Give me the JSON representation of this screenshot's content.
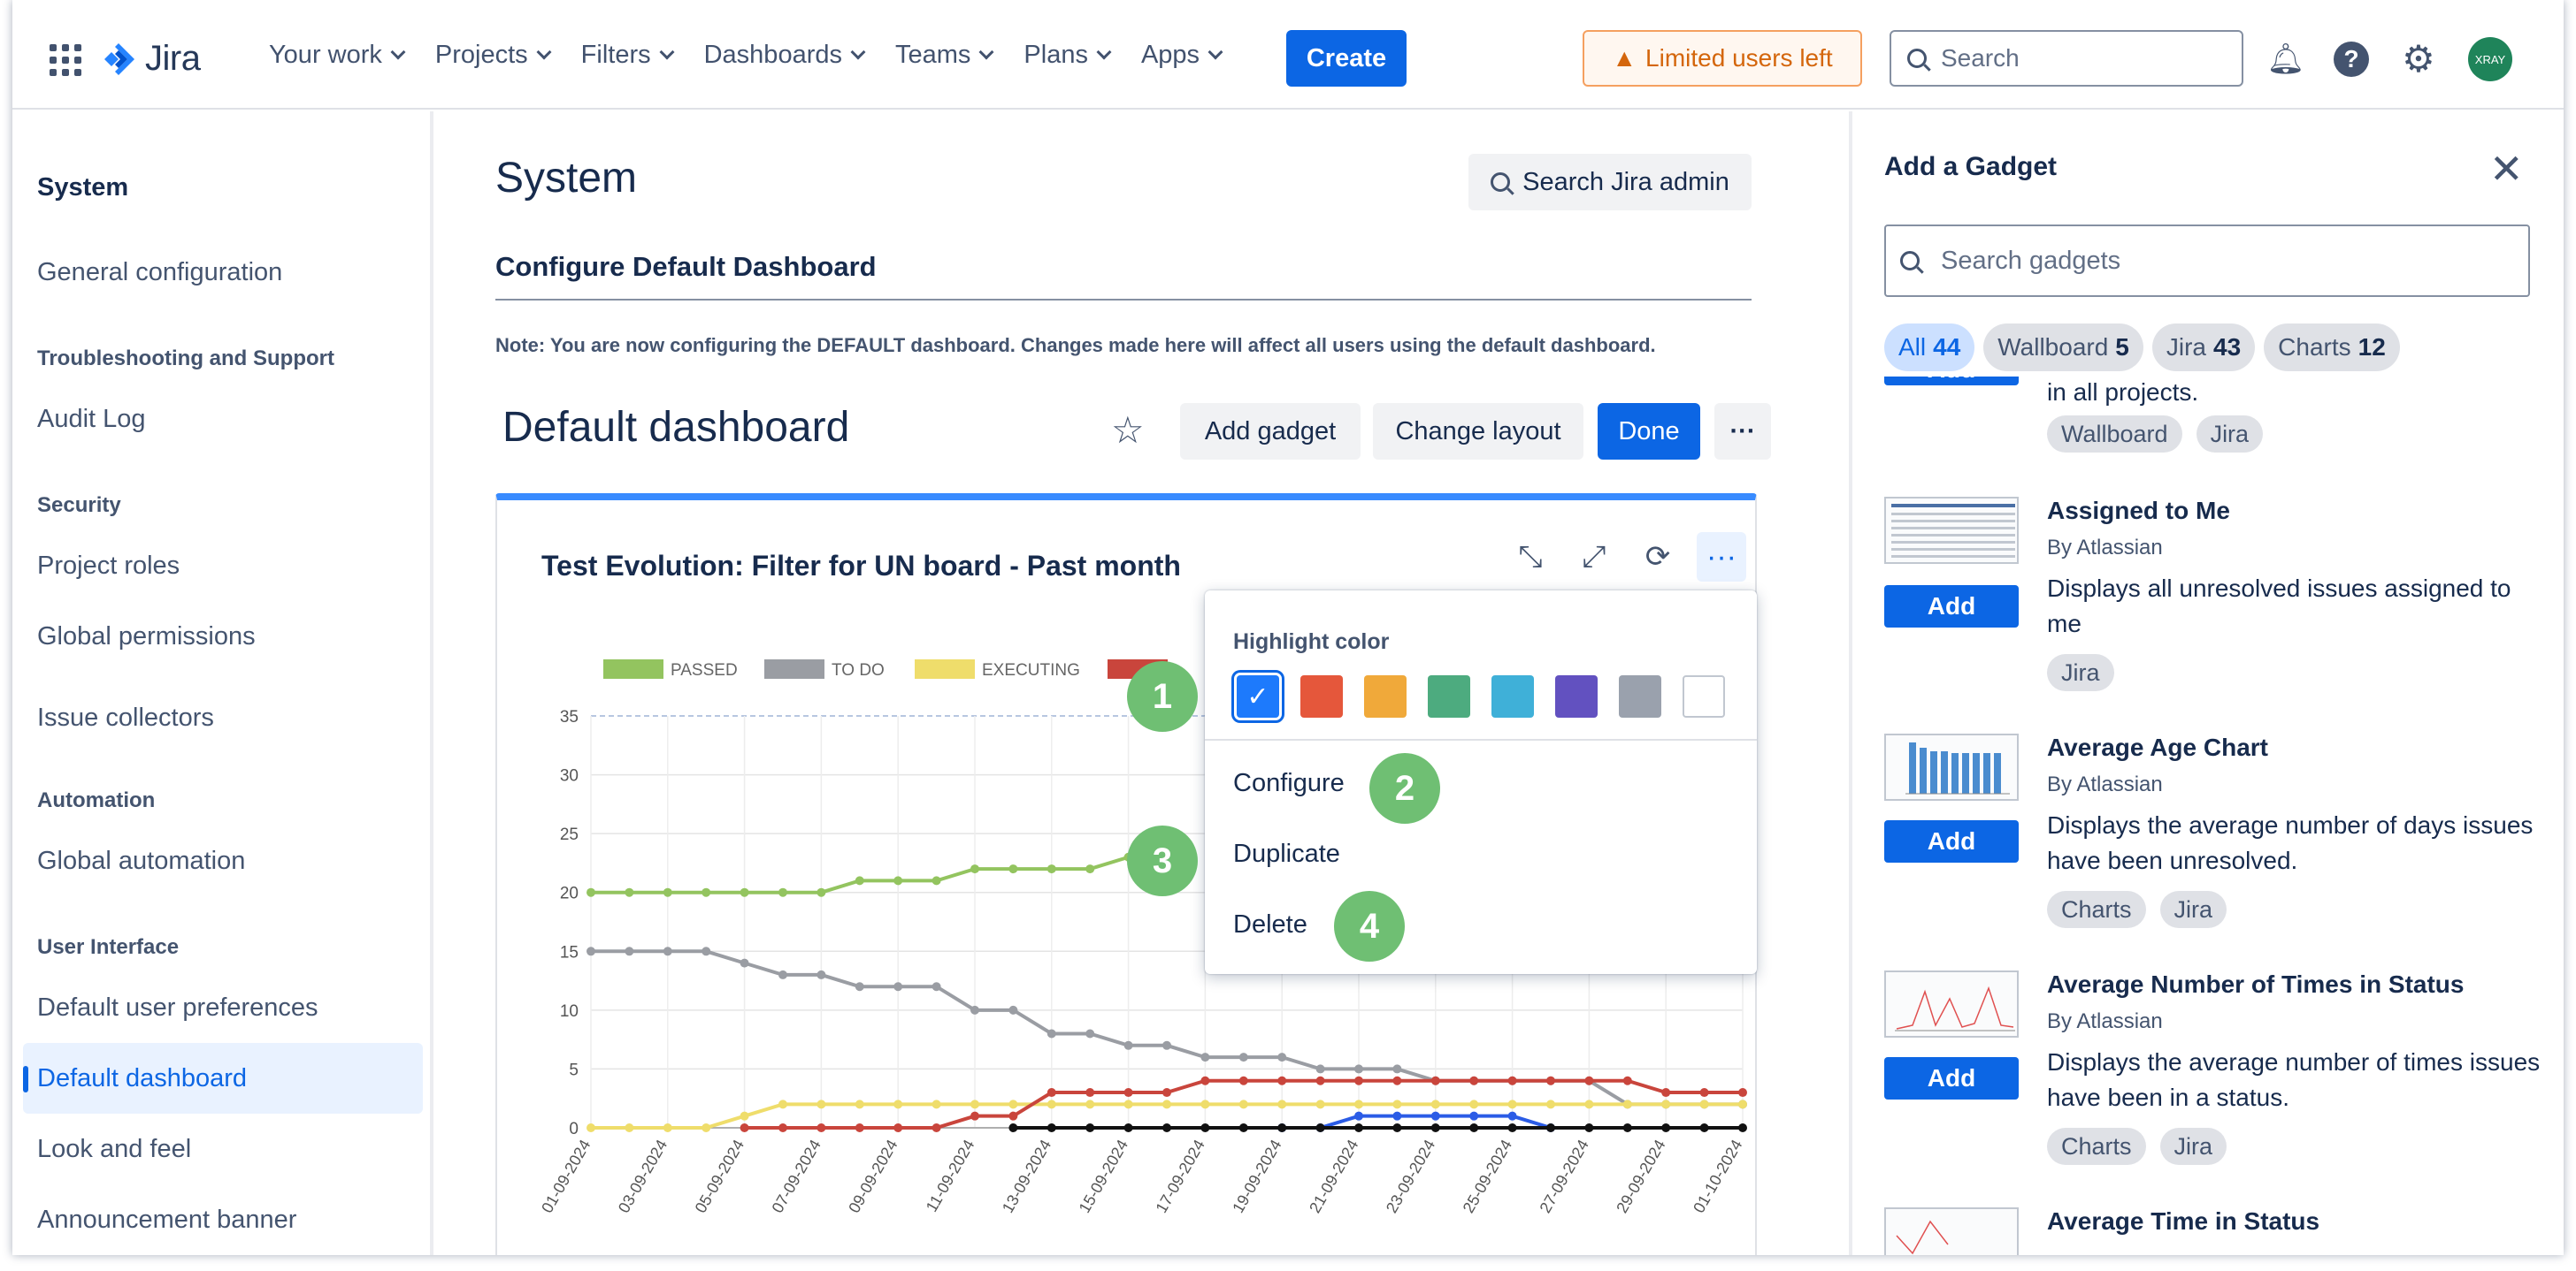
{
  "topnav": {
    "logo": "Jira",
    "items": [
      "Your work",
      "Projects",
      "Filters",
      "Dashboards",
      "Teams",
      "Plans",
      "Apps"
    ],
    "create": "Create",
    "limited": "Limited users left",
    "search_placeholder": "Search",
    "avatar": "XRAY"
  },
  "sidebar": {
    "title": "System",
    "general": "General configuration",
    "h_trouble": "Troubleshooting and Support",
    "audit": "Audit Log",
    "h_security": "Security",
    "project_roles": "Project roles",
    "global_permissions": "Global permissions",
    "issue_collectors": "Issue collectors",
    "h_automation": "Automation",
    "global_automation": "Global automation",
    "h_ui": "User Interface",
    "default_user_prefs": "Default user preferences",
    "default_dashboard": "Default dashboard",
    "look_feel": "Look and feel",
    "announcement": "Announcement banner"
  },
  "main": {
    "title": "System",
    "search_admin": "Search Jira admin",
    "configure_title": "Configure Default Dashboard",
    "note": "Note: You are now configuring the DEFAULT dashboard. Changes made here will affect all users using the default dashboard.",
    "dashboard_title": "Default dashboard",
    "add_gadget": "Add gadget",
    "change_layout": "Change layout",
    "done": "Done",
    "more": "···"
  },
  "gadget": {
    "title": "Test Evolution: Filter for UN board - Past month",
    "menu": {
      "highlight_label": "Highlight color",
      "configure": "Configure",
      "duplicate": "Duplicate",
      "delete": "Delete",
      "swatches": [
        "#1d7afc",
        "#e5573b",
        "#f0a93a",
        "#4dab7f",
        "#3fb0d8",
        "#6251c0",
        "#9aa1ad",
        "#ffffff"
      ]
    },
    "badges": [
      "1",
      "2",
      "3",
      "4"
    ]
  },
  "chart_data": {
    "type": "line",
    "legend": [
      "PASSED",
      "TO DO",
      "EXECUTING"
    ],
    "ylim": [
      0,
      35
    ],
    "yticks": [
      "0",
      "5",
      "10",
      "15",
      "20",
      "25",
      "30",
      "35"
    ],
    "categories": [
      "01-09-2024",
      "02-09-2024",
      "03-09-2024",
      "04-09-2024",
      "05-09-2024",
      "06-09-2024",
      "07-09-2024",
      "08-09-2024",
      "09-09-2024",
      "10-09-2024",
      "11-09-2024",
      "12-09-2024",
      "13-09-2024",
      "14-09-2024",
      "15-09-2024",
      "16-09-2024",
      "17-09-2024",
      "18-09-2024",
      "19-09-2024",
      "20-09-2024",
      "21-09-2024",
      "22-09-2024",
      "23-09-2024",
      "24-09-2024",
      "25-09-2024",
      "26-09-2024",
      "27-09-2024",
      "28-09-2024",
      "29-09-2024",
      "30-09-2024",
      "01-10-2024"
    ],
    "xticks": [
      "01-09-2024",
      "03-09-2024",
      "05-09-2024",
      "07-09-2024",
      "09-09-2024",
      "11-09-2024",
      "13-09-2024",
      "15-09-2024",
      "17-09-2024",
      "19-09-2024",
      "21-09-2024",
      "23-09-2024",
      "25-09-2024",
      "27-09-2024",
      "29-09-2024",
      "01-10-2024"
    ],
    "series": [
      {
        "name": "PASSED",
        "color": "#93c45f",
        "values": [
          20,
          20,
          20,
          20,
          20,
          20,
          20,
          21,
          21,
          21,
          22,
          22,
          22,
          22,
          23,
          23,
          null,
          null,
          null,
          null,
          null,
          null,
          null,
          null,
          null,
          null,
          null,
          null,
          null,
          null,
          null
        ]
      },
      {
        "name": "TO DO",
        "color": "#9a9da3",
        "values": [
          15,
          15,
          15,
          15,
          14,
          13,
          13,
          12,
          12,
          12,
          10,
          10,
          8,
          8,
          7,
          7,
          6,
          6,
          6,
          5,
          5,
          5,
          4,
          4,
          4,
          4,
          4,
          2,
          2,
          2,
          2
        ]
      },
      {
        "name": "EXECUTING",
        "color": "#efdd6b",
        "values": [
          0,
          0,
          0,
          0,
          1,
          2,
          2,
          2,
          2,
          2,
          2,
          2,
          2,
          2,
          2,
          2,
          2,
          2,
          2,
          2,
          2,
          2,
          2,
          2,
          2,
          2,
          2,
          2,
          2,
          2,
          2
        ]
      },
      {
        "color": "#c9453c",
        "values": [
          null,
          null,
          null,
          null,
          0,
          0,
          0,
          0,
          0,
          0,
          1,
          1,
          3,
          3,
          3,
          3,
          4,
          4,
          4,
          4,
          4,
          4,
          4,
          4,
          4,
          4,
          4,
          4,
          3,
          3,
          3
        ]
      },
      {
        "color": "#2b5ce6",
        "values": [
          null,
          null,
          null,
          null,
          null,
          null,
          null,
          null,
          null,
          null,
          null,
          null,
          null,
          null,
          null,
          null,
          null,
          null,
          0,
          0,
          1,
          1,
          1,
          1,
          1,
          0,
          null,
          null,
          null,
          null,
          null
        ]
      },
      {
        "color": "#111111",
        "values": [
          null,
          null,
          null,
          null,
          null,
          null,
          null,
          null,
          null,
          null,
          null,
          0,
          0,
          0,
          0,
          0,
          0,
          0,
          0,
          0,
          0,
          0,
          0,
          0,
          0,
          0,
          0,
          0,
          0,
          0,
          0
        ]
      }
    ]
  },
  "rpanel": {
    "title": "Add a Gadget",
    "search_placeholder": "Search gadgets",
    "tabs": [
      {
        "label": "All",
        "count": "44"
      },
      {
        "label": "Wallboard",
        "count": "5"
      },
      {
        "label": "Jira",
        "count": "43"
      },
      {
        "label": "Charts",
        "count": "12"
      }
    ],
    "add_label": "Add",
    "partial_desc": "in all projects.",
    "partial_chips": [
      "Wallboard",
      "Jira"
    ],
    "gadgets": [
      {
        "name": "Assigned to Me",
        "by": "By Atlassian",
        "desc": "Displays all unresolved issues assigned to me",
        "chips": [
          "Jira"
        ]
      },
      {
        "name": "Average Age Chart",
        "by": "By Atlassian",
        "desc": "Displays the average number of days issues have been unresolved.",
        "chips": [
          "Charts",
          "Jira"
        ]
      },
      {
        "name": "Average Number of Times in Status",
        "by": "By Atlassian",
        "desc": "Displays the average number of times issues have been in a status.",
        "chips": [
          "Charts",
          "Jira"
        ]
      },
      {
        "name": "Average Time in Status"
      }
    ]
  }
}
